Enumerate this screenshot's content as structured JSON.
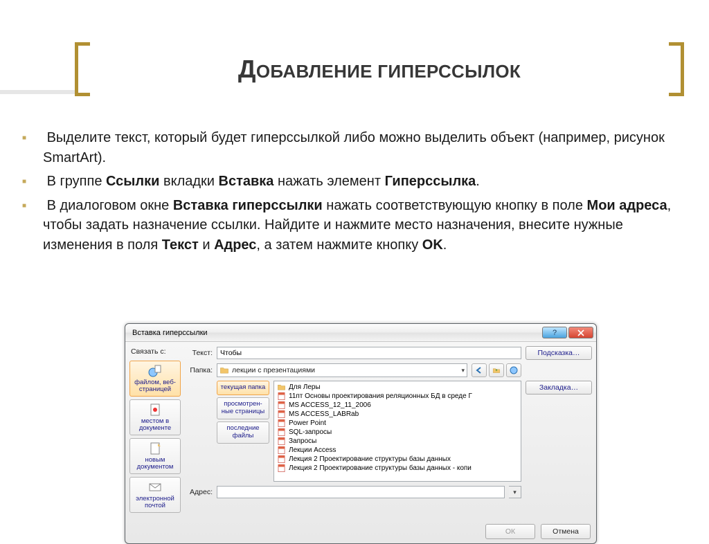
{
  "slide": {
    "title": "Добавление гиперссылок"
  },
  "bullets": [
    {
      "pre": "Выделите текст, который будет гиперссылкой либо можно выделить объект (например, рисунок SmartArt)."
    },
    {
      "pre": "В группе ",
      "b1": "Ссылки",
      "mid1": " вкладки ",
      "b2": "Вставка",
      "mid2": " нажать элемент ",
      "b3": "Гиперссылка",
      "post": "."
    },
    {
      "pre": "В диалоговом окне ",
      "b1": "Вставка гиперссылки",
      "mid1": " нажать соответствующую кнопку в поле ",
      "b2": "Мои адреса",
      "mid2": ", чтобы задать назначение ссылки. Найдите и нажмите место назначения, внесите нужные изменения в поля ",
      "b3": "Текст",
      "mid3": " и ",
      "b4": "Адрес",
      "mid4": ", а затем нажмите кнопку ",
      "b5": "OK",
      "post": "."
    }
  ],
  "dialog": {
    "title": "Вставка гиперссылки",
    "link_with_label": "Связать с:",
    "text_label": "Текст:",
    "text_value": "Чтобы",
    "tip_button": "Подсказка…",
    "folder_label": "Папка:",
    "folder_value": "лекции с презентациями",
    "rail": [
      {
        "label": "файлом, веб-страницей",
        "icon": "globe-file-icon"
      },
      {
        "label": "местом в документе",
        "icon": "doc-target-icon"
      },
      {
        "label": "новым документом",
        "icon": "new-doc-icon"
      },
      {
        "label": "электронной почтой",
        "icon": "mail-icon"
      }
    ],
    "view_tabs": [
      "текущая папка",
      "просмотрен-ные страницы",
      "последние файлы"
    ],
    "files": [
      {
        "icon": "folder",
        "name": "Для Леры"
      },
      {
        "icon": "ppt",
        "name": "11пт Основы проектирования реляционных БД в среде Г"
      },
      {
        "icon": "ppt",
        "name": "MS ACCESS_12_11_2006"
      },
      {
        "icon": "ppt",
        "name": "MS ACCESS_LABRab"
      },
      {
        "icon": "ppt",
        "name": "Power Point"
      },
      {
        "icon": "ppt",
        "name": "SQL-запросы"
      },
      {
        "icon": "ppt",
        "name": "Запросы"
      },
      {
        "icon": "ppt",
        "name": "Лекции Access"
      },
      {
        "icon": "ppt",
        "name": "Лекция 2 Проектирование структуры базы данных"
      },
      {
        "icon": "ppt",
        "name": "Лекция 2 Проектирование структуры базы данных - копи"
      }
    ],
    "bookmark_button": "Закладка…",
    "address_label": "Адрес:",
    "address_value": "",
    "ok": "ОК",
    "cancel": "Отмена"
  }
}
